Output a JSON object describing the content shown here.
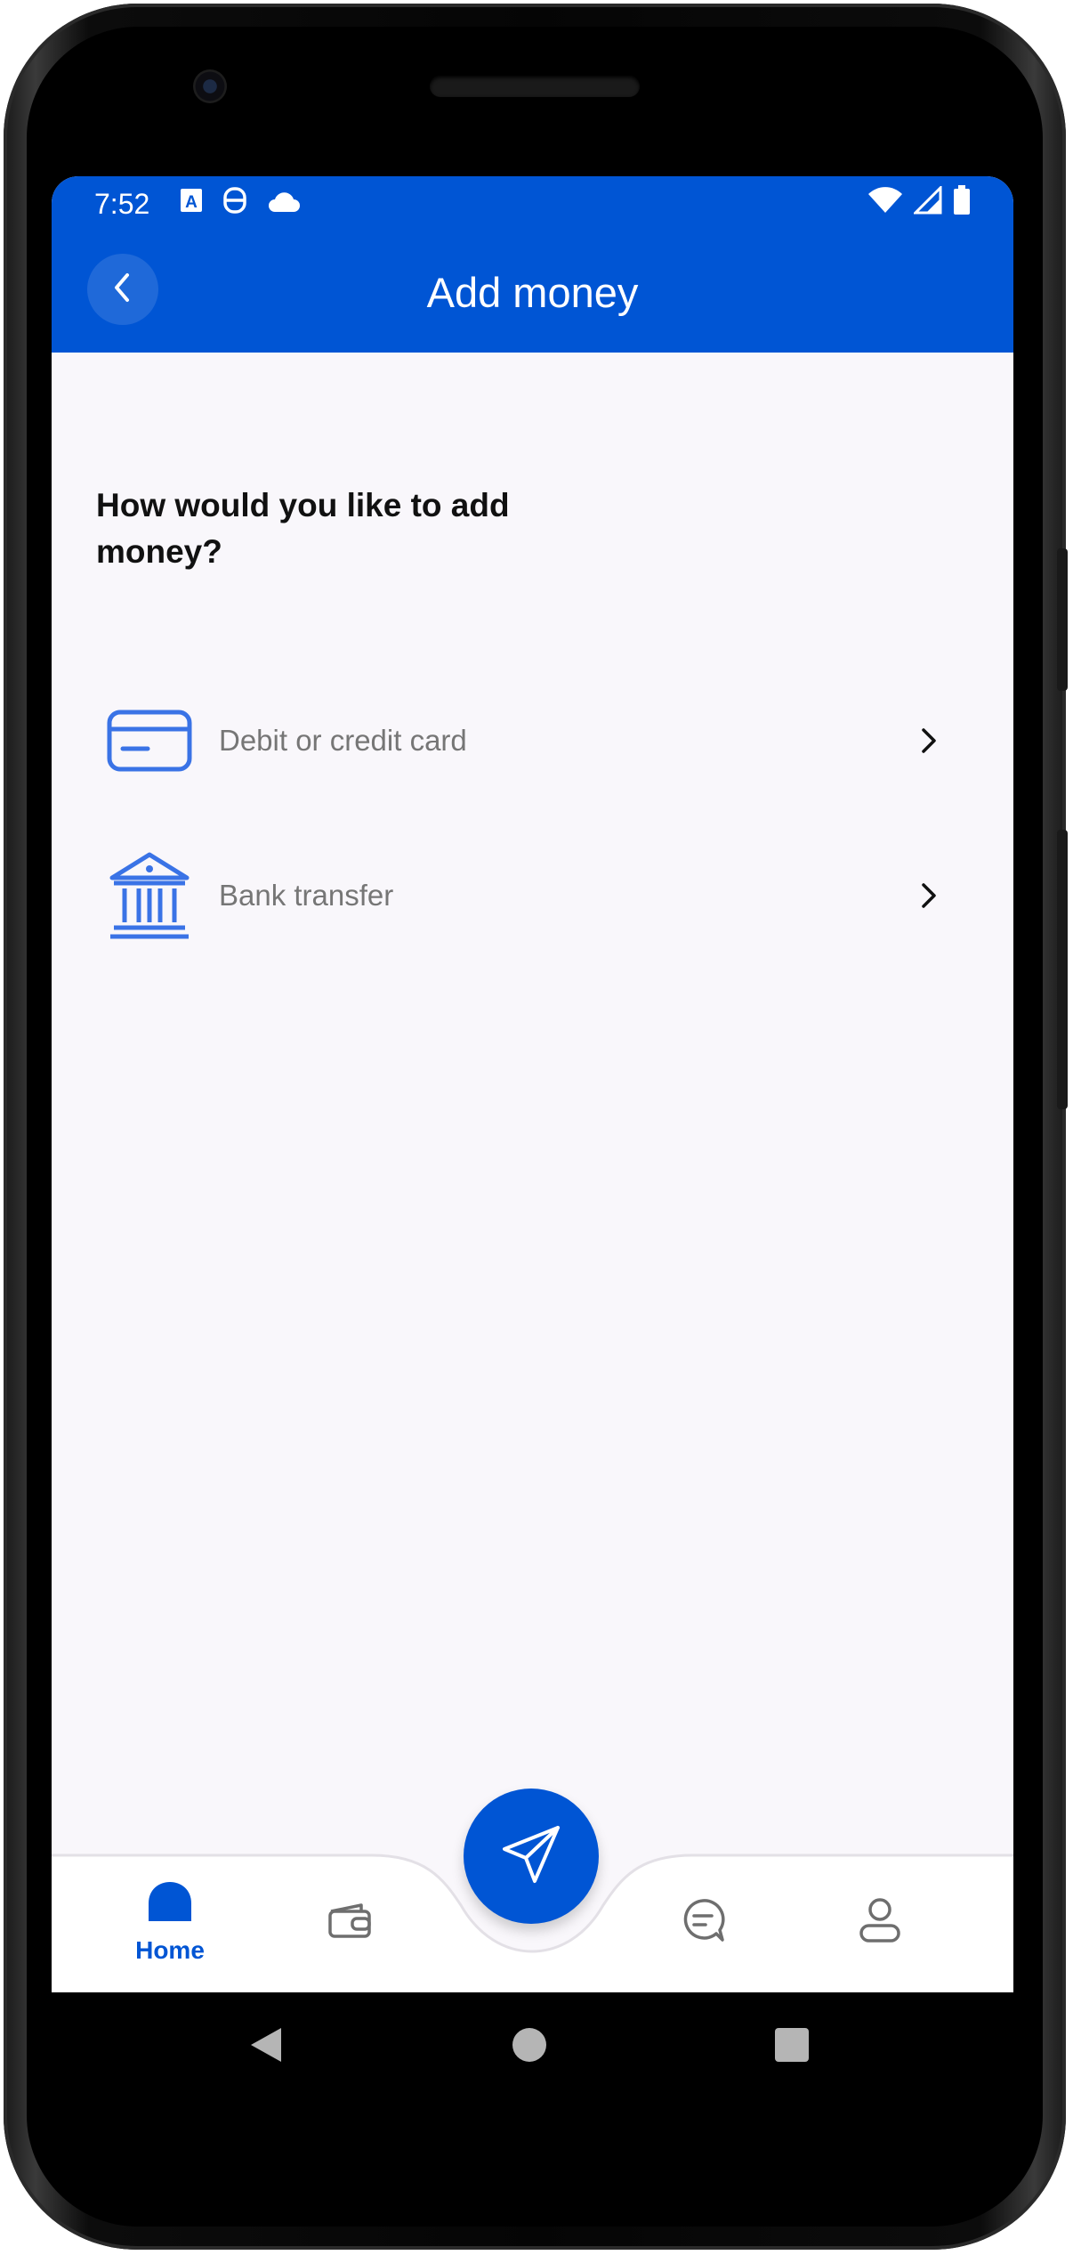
{
  "status_bar": {
    "time": "7:52",
    "left_icons": [
      "text-a-icon",
      "recorder-icon",
      "cloud-icon"
    ],
    "right_icons": [
      "wifi-icon",
      "signal-icon",
      "battery-icon"
    ]
  },
  "app_bar": {
    "title": "Add money",
    "back_icon": "chevron-left-icon"
  },
  "main": {
    "question": "How would you like to add money?",
    "options": [
      {
        "label": "Debit or credit card",
        "icon": "credit-card-icon"
      },
      {
        "label": "Bank transfer",
        "icon": "bank-icon"
      }
    ]
  },
  "bottom_nav": {
    "items": [
      {
        "label": "Home",
        "icon": "home-icon",
        "active": true
      },
      {
        "label": "",
        "icon": "wallet-icon",
        "active": false
      },
      {
        "label": "",
        "icon": "chat-icon",
        "active": false
      },
      {
        "label": "",
        "icon": "profile-icon",
        "active": false
      }
    ],
    "fab_icon": "send-icon"
  },
  "system_nav": [
    "back-triangle-icon",
    "home-circle-icon",
    "recents-square-icon"
  ],
  "colors": {
    "primary": "#0055d4",
    "icon_blue": "#3a73e6",
    "background": "#f9f7fb",
    "label_gray": "#767676"
  }
}
